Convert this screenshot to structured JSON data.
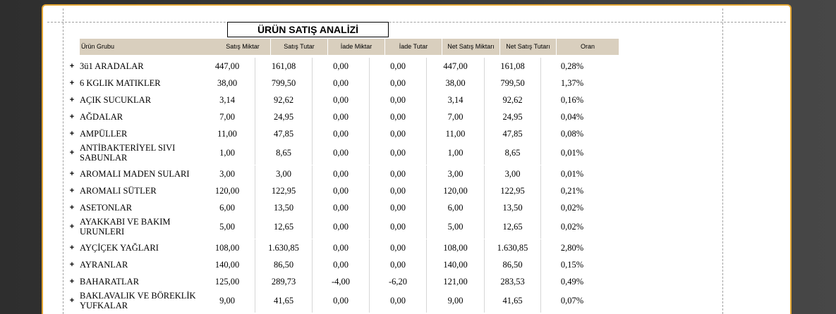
{
  "report": {
    "title": "ÜRÜN SATIŞ ANALİZİ",
    "columns": [
      "Ürün Grubu",
      "Satış Miktar",
      "Satış Tutar",
      "İade Miktar",
      "İade Tutar",
      "Net Satış Miktarı",
      "Net Satış Tutarı",
      "Oran"
    ],
    "expand_symbol": "+",
    "rows": [
      {
        "name": "3ü1 ARADALAR",
        "values": [
          "447,00",
          "161,08",
          "0,00",
          "0,00",
          "447,00",
          "161,08",
          "0,28%"
        ]
      },
      {
        "name": "6 KGLIK MATIKLER",
        "values": [
          "38,00",
          "799,50",
          "0,00",
          "0,00",
          "38,00",
          "799,50",
          "1,37%"
        ]
      },
      {
        "name": "AÇIK SUCUKLAR",
        "values": [
          "3,14",
          "92,62",
          "0,00",
          "0,00",
          "3,14",
          "92,62",
          "0,16%"
        ]
      },
      {
        "name": "AĞDALAR",
        "values": [
          "7,00",
          "24,95",
          "0,00",
          "0,00",
          "7,00",
          "24,95",
          "0,04%"
        ]
      },
      {
        "name": "AMPÜLLER",
        "values": [
          "11,00",
          "47,85",
          "0,00",
          "0,00",
          "11,00",
          "47,85",
          "0,08%"
        ]
      },
      {
        "name": "ANTİBAKTERİYEL SIVI SABUNLAR",
        "values": [
          "1,00",
          "8,65",
          "0,00",
          "0,00",
          "1,00",
          "8,65",
          "0,01%"
        ]
      },
      {
        "name": "AROMALI MADEN SULARI",
        "values": [
          "3,00",
          "3,00",
          "0,00",
          "0,00",
          "3,00",
          "3,00",
          "0,01%"
        ]
      },
      {
        "name": "AROMALI SÜTLER",
        "values": [
          "120,00",
          "122,95",
          "0,00",
          "0,00",
          "120,00",
          "122,95",
          "0,21%"
        ]
      },
      {
        "name": "ASETONLAR",
        "values": [
          "6,00",
          "13,50",
          "0,00",
          "0,00",
          "6,00",
          "13,50",
          "0,02%"
        ]
      },
      {
        "name": "AYAKKABI VE BAKIM URUNLERI",
        "values": [
          "5,00",
          "12,65",
          "0,00",
          "0,00",
          "5,00",
          "12,65",
          "0,02%"
        ]
      },
      {
        "name": "AYÇİÇEK YAĞLARI",
        "values": [
          "108,00",
          "1.630,85",
          "0,00",
          "0,00",
          "108,00",
          "1.630,85",
          "2,80%"
        ]
      },
      {
        "name": "AYRANLAR",
        "values": [
          "140,00",
          "86,50",
          "0,00",
          "0,00",
          "140,00",
          "86,50",
          "0,15%"
        ]
      },
      {
        "name": "BAHARATLAR",
        "values": [
          "125,00",
          "289,73",
          "-4,00",
          "-6,20",
          "121,00",
          "283,53",
          "0,49%"
        ]
      },
      {
        "name": "BAKLAVALIK VE BÖREKLİK YUFKALAR",
        "values": [
          "9,00",
          "41,65",
          "0,00",
          "0,00",
          "9,00",
          "41,65",
          "0,07%"
        ]
      }
    ]
  }
}
